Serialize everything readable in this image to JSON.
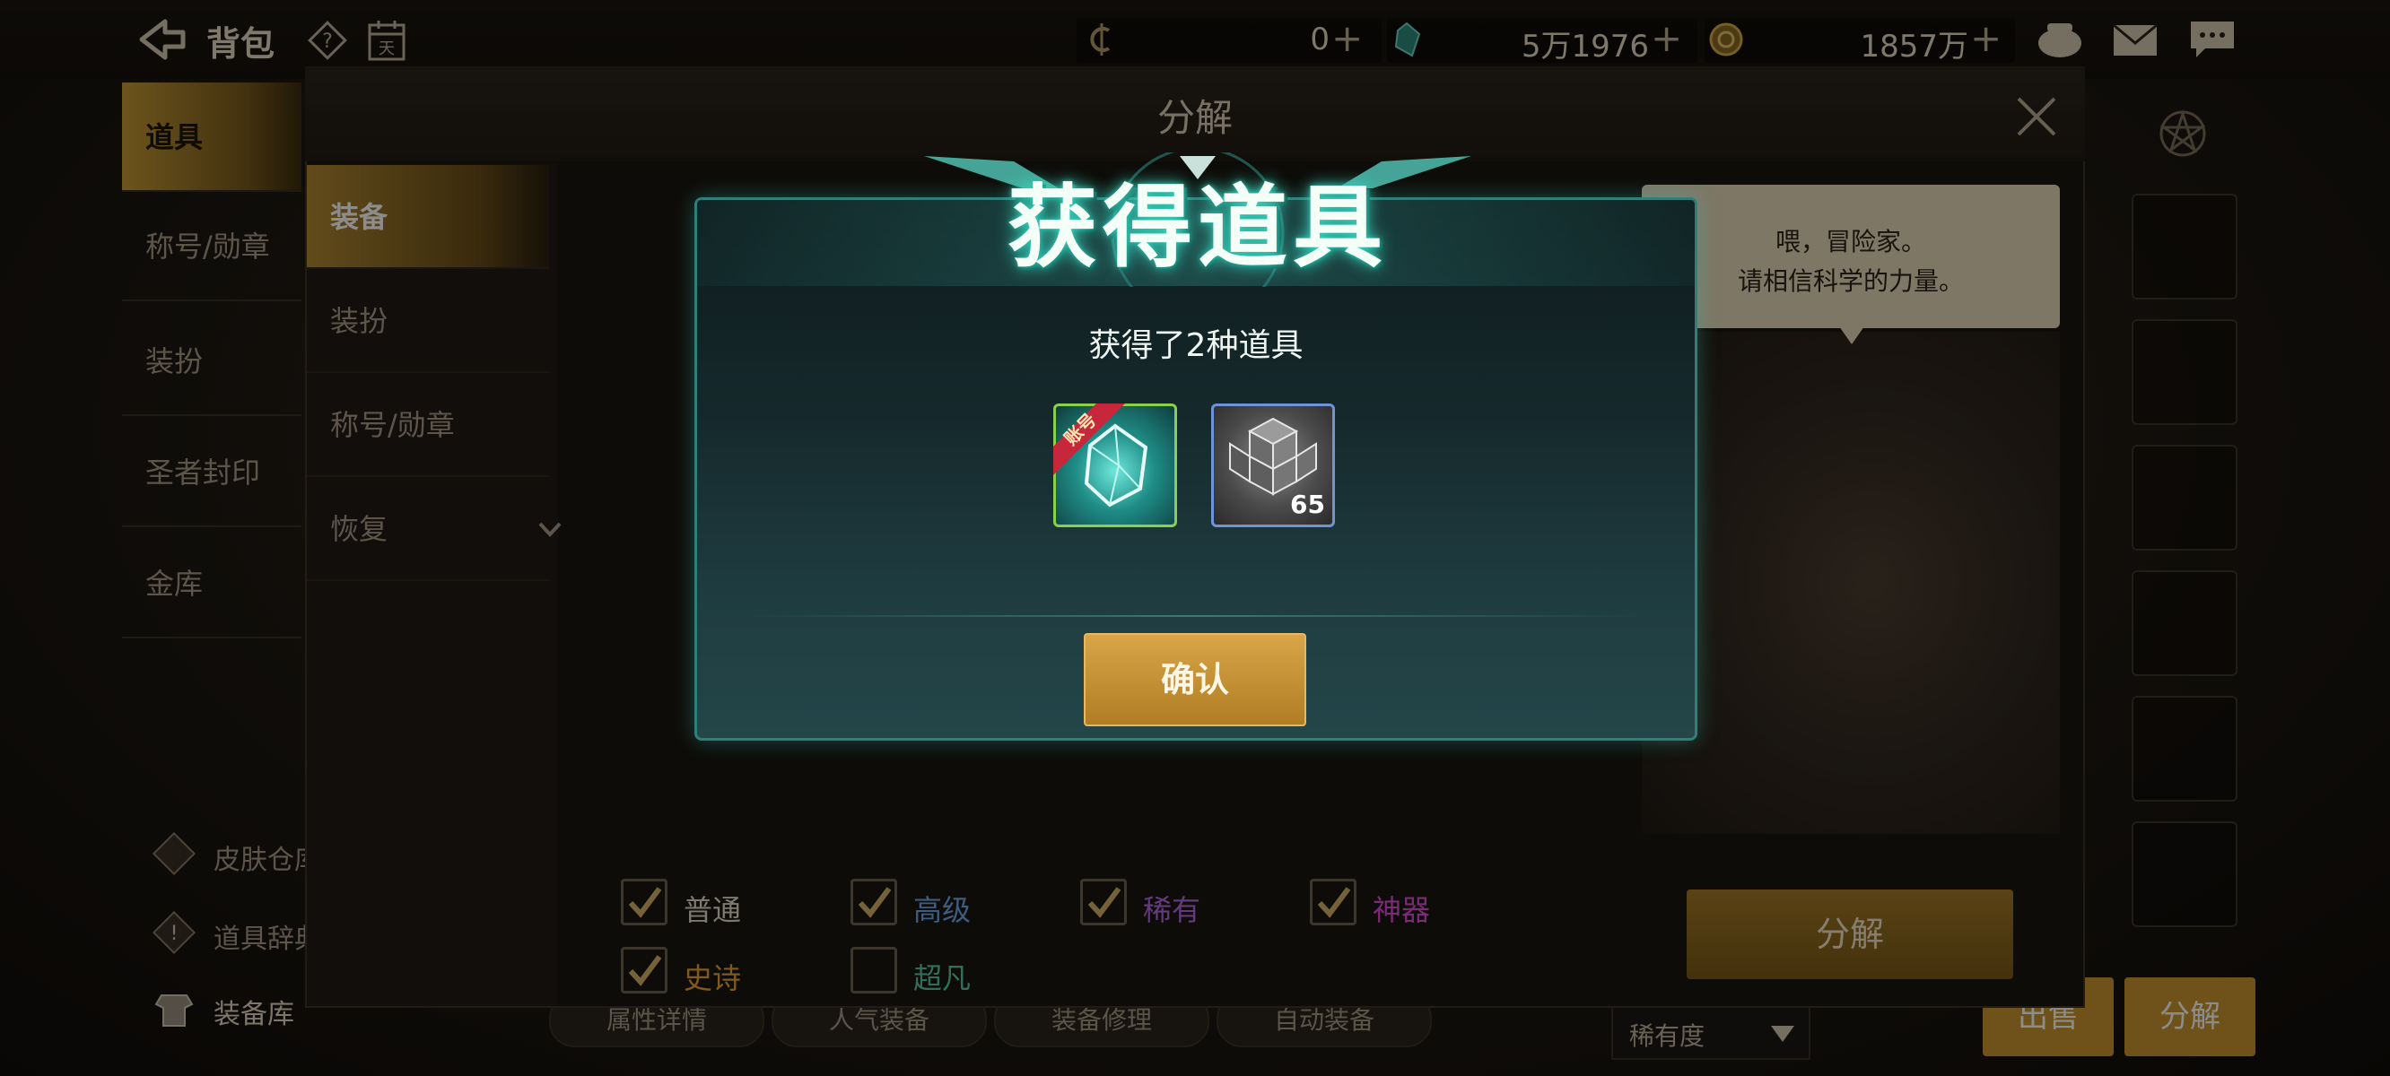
{
  "topbar": {
    "title": "背包",
    "currency1_value": "0",
    "currency2_value": "5万1976",
    "currency3_value": "1857万6140",
    "plus": "+"
  },
  "left_menu": {
    "items": [
      {
        "label": "道具",
        "active": true
      },
      {
        "label": "称号/勋章",
        "active": false
      },
      {
        "label": "装扮",
        "active": false
      },
      {
        "label": "圣者封印",
        "active": false
      },
      {
        "label": "金库",
        "active": false
      }
    ],
    "bottom": [
      {
        "label": "皮肤仓库"
      },
      {
        "label": "道具辞典"
      },
      {
        "label": "装备库"
      }
    ]
  },
  "background_page": {
    "tabs": [
      "属性详情",
      "人气装备",
      "装备修理",
      "自动装备"
    ],
    "sort_label": "稀有度",
    "sell_label": "出售",
    "decompose_label": "分解"
  },
  "panel": {
    "title": "分解",
    "menu": [
      {
        "label": "装备",
        "active": true
      },
      {
        "label": "装扮",
        "active": false
      },
      {
        "label": "称号/勋章",
        "active": false
      },
      {
        "label": "恢复",
        "active": false
      }
    ],
    "npc_line1": "喂，冒险家。",
    "npc_line2": "请相信科学的力量。",
    "filters": [
      {
        "label": "普通",
        "checked": true,
        "color": "#e6dcc8"
      },
      {
        "label": "高级",
        "checked": true,
        "color": "#6fa8e8"
      },
      {
        "label": "稀有",
        "checked": true,
        "color": "#b46be0"
      },
      {
        "label": "神器",
        "checked": true,
        "color": "#e04fd8"
      },
      {
        "label": "史诗",
        "checked": true,
        "color": "#e8a23a"
      },
      {
        "label": "超凡",
        "checked": false,
        "color": "#58c8a8"
      }
    ],
    "decompose_button": "分解"
  },
  "dialog": {
    "banner": "获得道具",
    "subtitle": "获得了2种道具",
    "items": [
      {
        "name": "crystal-item",
        "tag": "账号",
        "count": ""
      },
      {
        "name": "cube-item",
        "tag": "",
        "count": "65"
      }
    ],
    "confirm": "确认"
  },
  "colors": {
    "gold": "#c8962f",
    "teal": "#2f7f7a"
  }
}
